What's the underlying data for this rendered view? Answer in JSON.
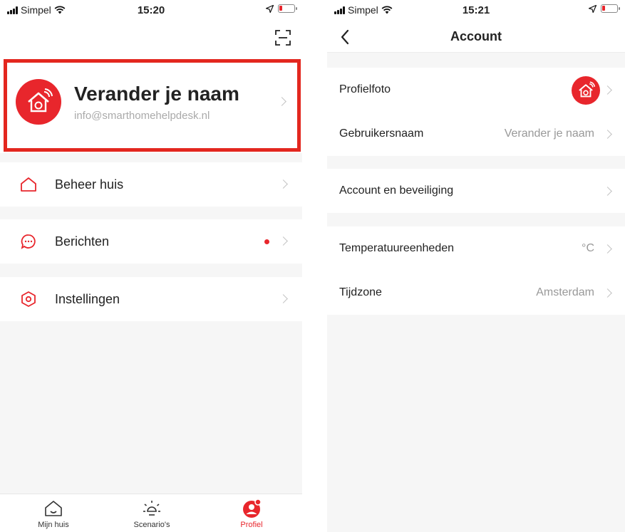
{
  "colors": {
    "accent": "#e8262c",
    "highlight_border": "#e3271f",
    "muted_text": "#aaaaaa",
    "background": "#f6f6f6"
  },
  "left": {
    "status": {
      "carrier": "Simpel",
      "time": "15:20"
    },
    "profile": {
      "name": "Verander je naam",
      "email": "info@smarthomehelpdesk.nl",
      "icon": "smart-home-avatar-icon"
    },
    "menu": [
      {
        "label": "Beheer huis",
        "icon": "home-outline-icon"
      },
      {
        "label": "Berichten",
        "icon": "chat-bubble-icon",
        "unread_dot": true
      },
      {
        "label": "Instellingen",
        "icon": "hexagon-settings-icon"
      }
    ],
    "tabs": [
      {
        "label": "Mijn huis",
        "icon": "home-icon",
        "active": false
      },
      {
        "label": "Scenario's",
        "icon": "sun-icon",
        "active": false
      },
      {
        "label": "Profiel",
        "icon": "profile-icon",
        "active": true
      }
    ]
  },
  "right": {
    "status": {
      "carrier": "Simpel",
      "time": "15:21"
    },
    "title": "Account",
    "groups": [
      [
        {
          "label": "Profielfoto",
          "value": "",
          "avatar": true
        },
        {
          "label": "Gebruikersnaam",
          "value": "Verander je naam"
        }
      ],
      [
        {
          "label": "Account en beveiliging",
          "value": ""
        }
      ],
      [
        {
          "label": "Temperatuureenheden",
          "value": "°C"
        },
        {
          "label": "Tijdzone",
          "value": "Amsterdam"
        }
      ]
    ]
  }
}
